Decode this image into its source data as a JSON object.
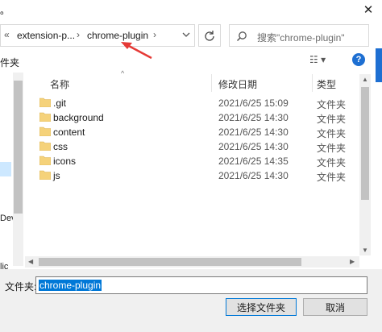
{
  "window": {
    "title_fragment": "。",
    "close_glyph": "✕"
  },
  "address_bar": {
    "nav_glyph": "«",
    "crumbs": [
      "extension-p...",
      "chrome-plugin"
    ],
    "separator": "›"
  },
  "search": {
    "placeholder": "搜索\"chrome-plugin\""
  },
  "toolbar": {
    "new_folder_fragment": "件夹",
    "view_glyph": "☷ ▾",
    "help_glyph": "?"
  },
  "nav_pane": {
    "fragments": [
      "Dev",
      "lic"
    ]
  },
  "columns": {
    "name": "名称",
    "modified": "修改日期",
    "type": "类型"
  },
  "files": [
    {
      "name": ".git",
      "modified": "2021/6/25 15:09",
      "type": "文件夹"
    },
    {
      "name": "background",
      "modified": "2021/6/25 14:30",
      "type": "文件夹"
    },
    {
      "name": "content",
      "modified": "2021/6/25 14:30",
      "type": "文件夹"
    },
    {
      "name": "css",
      "modified": "2021/6/25 14:30",
      "type": "文件夹"
    },
    {
      "name": "icons",
      "modified": "2021/6/25 14:35",
      "type": "文件夹"
    },
    {
      "name": "js",
      "modified": "2021/6/25 14:30",
      "type": "文件夹"
    }
  ],
  "footer": {
    "folder_label": "文件夹:",
    "folder_value": "chrome-plugin",
    "select_button": "选择文件夹",
    "cancel_button": "取消"
  },
  "colors": {
    "accent": "#0078d7",
    "folder": "#f5d27a",
    "annotation_arrow": "#e53935"
  }
}
